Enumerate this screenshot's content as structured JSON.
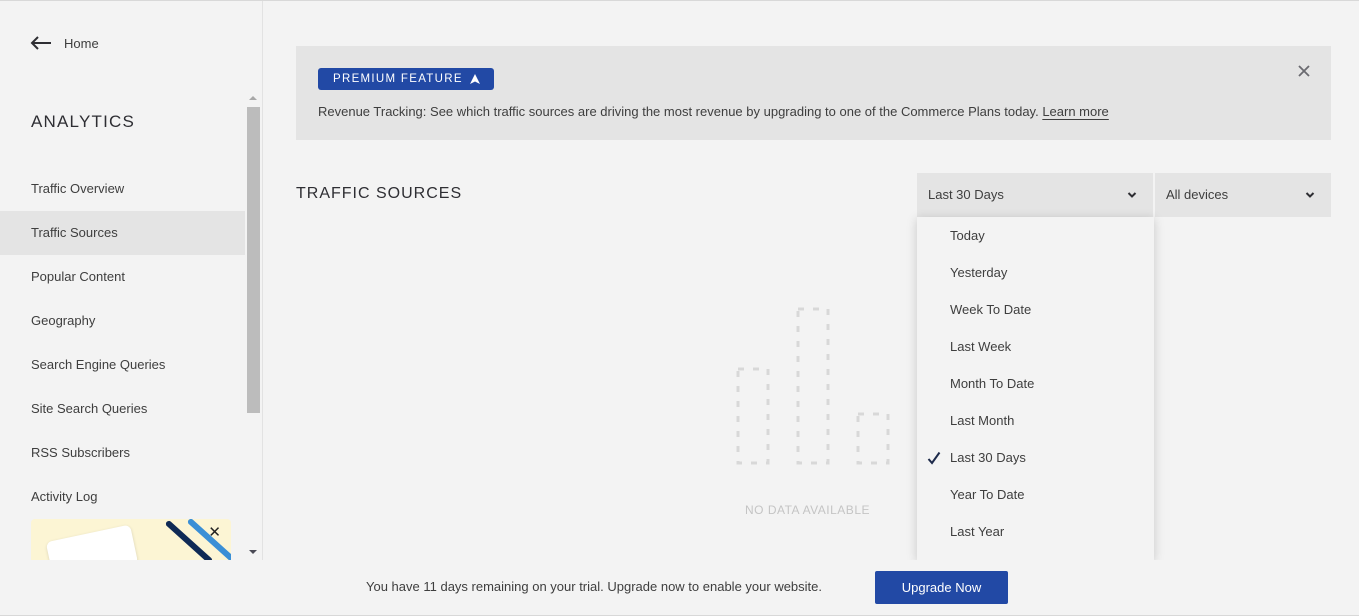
{
  "sidebar": {
    "home_label": "Home",
    "section_title": "ANALYTICS",
    "items": [
      {
        "label": "Traffic Overview",
        "active": false
      },
      {
        "label": "Traffic Sources",
        "active": true
      },
      {
        "label": "Popular Content",
        "active": false
      },
      {
        "label": "Geography",
        "active": false
      },
      {
        "label": "Search Engine Queries",
        "active": false
      },
      {
        "label": "Site Search Queries",
        "active": false
      },
      {
        "label": "RSS Subscribers",
        "active": false
      },
      {
        "label": "Activity Log",
        "active": false
      }
    ],
    "promo_close": "✕"
  },
  "banner": {
    "badge_label": "PREMIUM FEATURE",
    "title": "Revenue Tracking:",
    "message": " See which traffic sources are driving the most revenue by upgrading to one of the Commerce Plans today. ",
    "link_label": "Learn more"
  },
  "main": {
    "page_title": "TRAFFIC SOURCES",
    "range_select": {
      "value": "Last 30 Days",
      "options": [
        {
          "label": "Today",
          "selected": false
        },
        {
          "label": "Yesterday",
          "selected": false
        },
        {
          "label": "Week To Date",
          "selected": false
        },
        {
          "label": "Last Week",
          "selected": false
        },
        {
          "label": "Month To Date",
          "selected": false
        },
        {
          "label": "Last Month",
          "selected": false
        },
        {
          "label": "Last 30 Days",
          "selected": true
        },
        {
          "label": "Year To Date",
          "selected": false
        },
        {
          "label": "Last Year",
          "selected": false
        }
      ]
    },
    "device_select": {
      "value": "All devices"
    },
    "empty_state": "NO DATA AVAILABLE"
  },
  "trial": {
    "message": "You have 11 days remaining on your trial. Upgrade now to enable your website.",
    "button_label": "Upgrade Now"
  },
  "colors": {
    "brand_blue": "#2249a5",
    "background": "#f3f3f3",
    "panel": "#e4e4e4"
  }
}
